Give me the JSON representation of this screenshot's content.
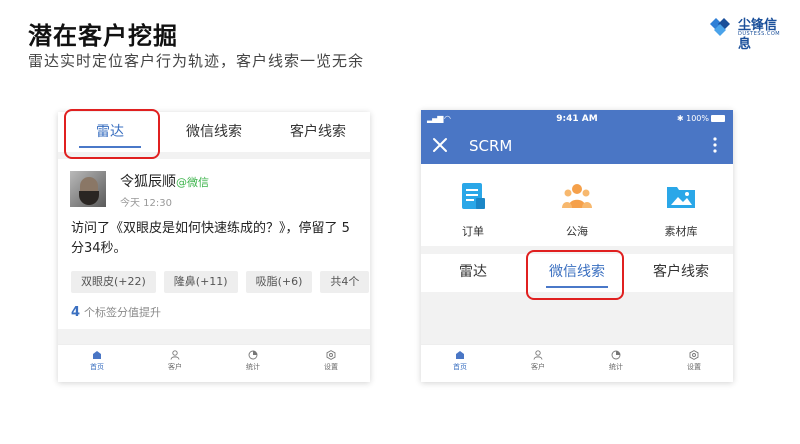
{
  "page": {
    "title": "潜在客户挖掘",
    "subtitle": "雷达实时定位客户行为轨迹，客户线索一览无余"
  },
  "logo": {
    "name": "尘锋信息",
    "sub": "DUSTESS.COM",
    "icon": "dustess-logo-icon",
    "color": "#1a4f9a"
  },
  "left_phone": {
    "tabs": [
      {
        "label": "雷达",
        "active": true
      },
      {
        "label": "微信线索",
        "active": false
      },
      {
        "label": "客户线索",
        "active": false
      }
    ],
    "feed": {
      "customer_name": "令狐辰顺",
      "source": "@微信",
      "time": "今天 12:30",
      "description": "访问了《双眼皮是如何快速练成的？》，停留了 5分34秒。",
      "tags": [
        "双眼皮(+22)",
        "隆鼻(+11)",
        "吸脂(+6)",
        "共4个"
      ],
      "tag_summary_count": "4",
      "tag_summary_text": "个标签分值提升"
    },
    "bottom_nav": [
      {
        "label": "首页",
        "icon": "home-icon",
        "active": true
      },
      {
        "label": "客户",
        "icon": "customer-icon",
        "active": false
      },
      {
        "label": "统计",
        "icon": "stats-icon",
        "active": false
      },
      {
        "label": "设置",
        "icon": "settings-icon",
        "active": false
      }
    ]
  },
  "right_phone": {
    "status": {
      "time": "9:41 AM",
      "battery": "100%"
    },
    "header": {
      "title": "SCRM"
    },
    "quick_items": [
      {
        "label": "订单",
        "icon": "order-icon",
        "color": "#2aa7e8"
      },
      {
        "label": "公海",
        "icon": "public-pool-icon",
        "color": "#f5a04a"
      },
      {
        "label": "素材库",
        "icon": "material-library-icon",
        "color": "#2aa7e8"
      }
    ],
    "tabs": [
      {
        "label": "雷达",
        "active": false
      },
      {
        "label": "微信线索",
        "active": true
      },
      {
        "label": "客户线索",
        "active": false
      }
    ],
    "bottom_nav": [
      {
        "label": "首页",
        "icon": "home-icon",
        "active": true
      },
      {
        "label": "客户",
        "icon": "customer-icon",
        "active": false
      },
      {
        "label": "统计",
        "icon": "stats-icon",
        "active": false
      },
      {
        "label": "设置",
        "icon": "settings-icon",
        "active": false
      }
    ]
  },
  "colors": {
    "accent": "#4a76c5",
    "highlight_ring": "#e02020",
    "source_green": "#3bb34a"
  }
}
